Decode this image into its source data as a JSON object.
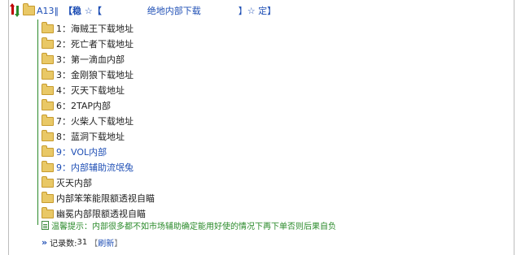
{
  "header": {
    "root_label": "A13‖",
    "bracket_left": "【稳 ☆【",
    "title": "绝地内部下载",
    "bracket_right": "】☆ 定】"
  },
  "items": [
    {
      "label": "1：海贼王下载地址"
    },
    {
      "label": "2：死亡者下载地址"
    },
    {
      "label": "3：第一滴血内部"
    },
    {
      "label": "3：金刚狼下载地址"
    },
    {
      "label": "4：灭天下载地址"
    },
    {
      "label": "6：2TAP内部"
    },
    {
      "label": "7：火柴人下载地址"
    },
    {
      "label": "8：蓝洞下载地址"
    },
    {
      "label": "9：VOL内部"
    },
    {
      "label": "9：内部辅助流氓兔"
    },
    {
      "label": "灭天内部"
    },
    {
      "label": "内部笨笨能限额透视自瞄"
    },
    {
      "label": "幽冕内部限额透视自瞄"
    }
  ],
  "tip": {
    "label": "温馨提示：",
    "text": "内部很多都不如市场辅助确定能用好使的情况下再下单否则后果自负"
  },
  "footer": {
    "count_label": "记录数:",
    "count_value": "31",
    "refresh_open": "【",
    "refresh_label": "刷新",
    "refresh_close": "】"
  },
  "colors": {
    "link_blue": "#1f4fb5",
    "tree_green": "#2a8a2a",
    "folder_yellow": "#e9c866"
  }
}
